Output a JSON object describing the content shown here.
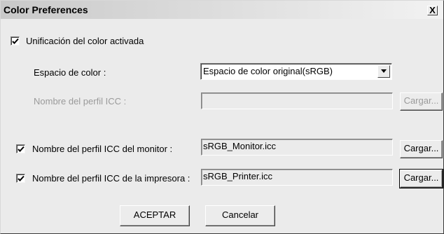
{
  "window": {
    "title": "Color Preferences",
    "close_label": "X"
  },
  "color_unification": {
    "checked": true,
    "label": "Unificación del color activada"
  },
  "color_space": {
    "label": "Espacio de color :",
    "selected": "Espacio de color original(sRGB)"
  },
  "icc_profile": {
    "label": "Nombre del perfil ICC :",
    "value": "",
    "load_label": "Cargar...",
    "enabled": false
  },
  "monitor_profile": {
    "checked": true,
    "label": "Nombre del perfil ICC del monitor :",
    "value": "sRGB_Monitor.icc",
    "load_label": "Cargar..."
  },
  "printer_profile": {
    "checked": true,
    "label": "Nombre del perfil ICC de la impresora :",
    "value": "sRGB_Printer.icc",
    "load_label": "Cargar..."
  },
  "actions": {
    "accept_label": "ACEPTAR",
    "cancel_label": "Cancelar"
  },
  "icons": {
    "check": "checkmark-icon",
    "dropdown": "triangle-down-icon",
    "close": "close-x-icon"
  }
}
